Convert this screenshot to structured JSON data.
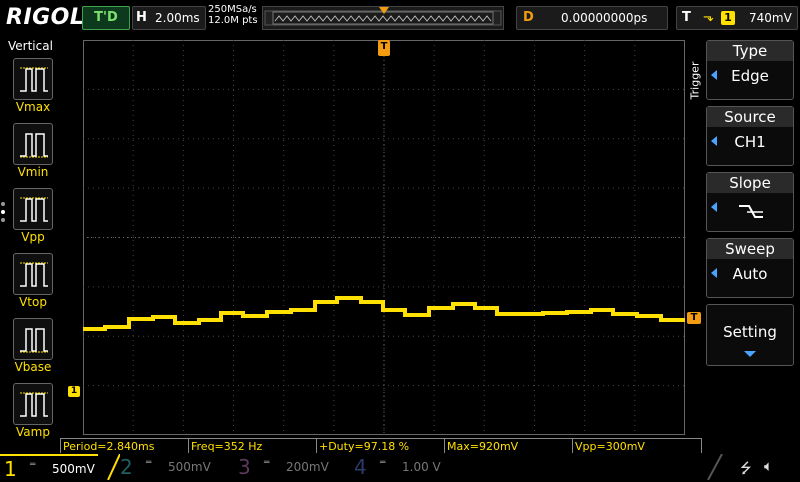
{
  "header": {
    "logo": "RIGOL",
    "run_status": "T'D",
    "horizontal": {
      "letter": "H",
      "value": "2.00ms"
    },
    "sample_rate": "250MSa/s",
    "memory_depth": "12.0M pts",
    "delay": {
      "letter": "D",
      "value": "0.00000000ps"
    },
    "trigger": {
      "letter": "T",
      "channel": "1",
      "level": "740mV"
    }
  },
  "left_menu": {
    "title": "Vertical",
    "items": [
      {
        "label": "Vmax"
      },
      {
        "label": "Vmin"
      },
      {
        "label": "Vpp"
      },
      {
        "label": "Vtop"
      },
      {
        "label": "Vbase"
      },
      {
        "label": "Vamp"
      }
    ]
  },
  "right_menu": {
    "tab": "Trigger",
    "keys": [
      {
        "title": "Type",
        "value": "Edge"
      },
      {
        "title": "Source",
        "value": "CH1"
      },
      {
        "title": "Slope",
        "value": ""
      },
      {
        "title": "Sweep",
        "value": "Auto"
      },
      {
        "title": "",
        "value": "Setting"
      }
    ]
  },
  "markers": {
    "trigger_position": "T",
    "trigger_level": "T",
    "channel_ground": "1"
  },
  "measurements": [
    {
      "text": "Period=2.840ms"
    },
    {
      "text": "Freq=352 Hz"
    },
    {
      "text": "+Duty=97.18 %"
    },
    {
      "text": "Max=920mV"
    },
    {
      "text": "Vpp=300mV"
    }
  ],
  "channels": [
    {
      "num": "1",
      "value": "500mV"
    },
    {
      "num": "2",
      "value": "500mV"
    },
    {
      "num": "3",
      "value": "200mV"
    },
    {
      "num": "4",
      "value": "1.00 V"
    }
  ],
  "colors": {
    "ch1": "#ffe000",
    "trigger": "#f39c12",
    "menu_arrow": "#4aa3ff"
  },
  "icons": {
    "usb": "usb-icon",
    "mute": "speaker-mute-icon"
  }
}
